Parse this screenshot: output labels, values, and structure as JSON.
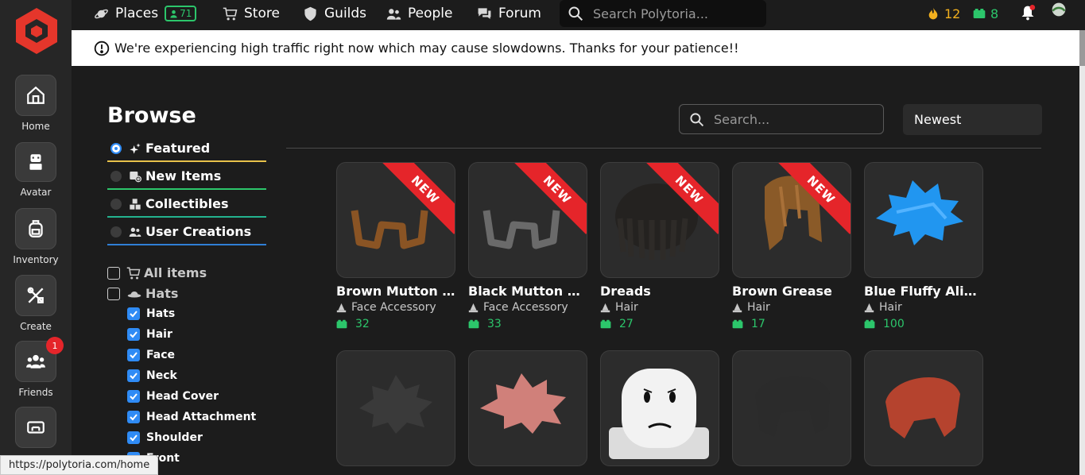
{
  "nav": {
    "places": "Places",
    "places_online": "71",
    "store": "Store",
    "guilds": "Guilds",
    "people": "People",
    "forum": "Forum",
    "search_placeholder": "Search Polytoria...",
    "stars": "12",
    "bricks": "8"
  },
  "sidebar": {
    "items": [
      {
        "label": "Home",
        "icon": "home-icon"
      },
      {
        "label": "Avatar",
        "icon": "avatar-icon"
      },
      {
        "label": "Inventory",
        "icon": "backpack-icon"
      },
      {
        "label": "Create",
        "icon": "tools-icon"
      },
      {
        "label": "Friends",
        "icon": "friends-icon",
        "badge": "1"
      },
      {
        "label": "",
        "icon": "ticket-icon"
      }
    ]
  },
  "banner": {
    "text": "We're experiencing high traffic right now which may cause slowdowns. Thanks for your patience!!"
  },
  "browse": {
    "title": "Browse",
    "categories": [
      {
        "label": "Featured",
        "selected": true,
        "underline": "#e8c24a"
      },
      {
        "label": "New Items",
        "selected": false,
        "underline": "#2cc66b"
      },
      {
        "label": "Collectibles",
        "selected": false,
        "underline": "#23b38f"
      },
      {
        "label": "User Creations",
        "selected": false,
        "underline": "#2f7fd6"
      }
    ],
    "filters": {
      "all_items": "All items",
      "hats_group": "Hats",
      "subfilters": [
        "Hats",
        "Hair",
        "Face",
        "Neck",
        "Head Cover",
        "Head Attachment",
        "Shoulder",
        "Front"
      ]
    }
  },
  "catalog": {
    "search_placeholder": "Search...",
    "sort": "Newest",
    "new_label": "NEW",
    "items": [
      {
        "name": "Brown Mutton C...",
        "type": "Face Accessory",
        "price": "32",
        "new": true
      },
      {
        "name": "Black Mutton Ch...",
        "type": "Face Accessory",
        "price": "33",
        "new": true
      },
      {
        "name": "Dreads",
        "type": "Hair",
        "price": "27",
        "new": true
      },
      {
        "name": "Brown Grease",
        "type": "Hair",
        "price": "17",
        "new": true
      },
      {
        "name": "Blue Fluffy Alien ...",
        "type": "Hair",
        "price": "100",
        "new": false
      }
    ]
  },
  "statusbar": {
    "url": "https://polytoria.com/home"
  },
  "colors": {
    "accent_red": "#e5252a",
    "brick_green": "#2cc66b",
    "star_gold": "#f2b01e",
    "check_blue": "#2f8bf5"
  }
}
